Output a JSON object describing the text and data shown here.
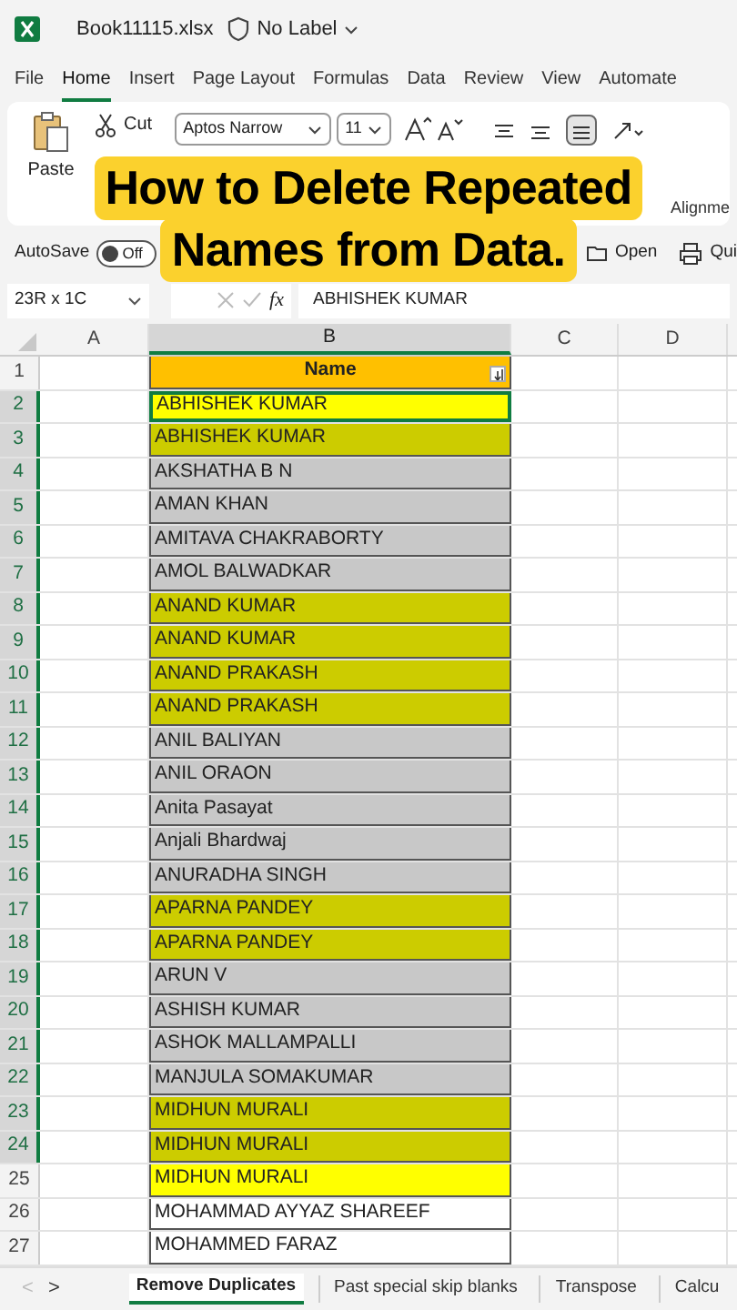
{
  "title_bar": {
    "file_name": "Book11115.xlsx",
    "label": "No Label"
  },
  "menu_tabs": [
    {
      "label": "File",
      "selected": false
    },
    {
      "label": "Home",
      "selected": true
    },
    {
      "label": "Insert",
      "selected": false
    },
    {
      "label": "Page Layout",
      "selected": false
    },
    {
      "label": "Formulas",
      "selected": false
    },
    {
      "label": "Data",
      "selected": false
    },
    {
      "label": "Review",
      "selected": false
    },
    {
      "label": "View",
      "selected": false
    },
    {
      "label": "Automate",
      "selected": false
    }
  ],
  "ribbon": {
    "paste": "Paste",
    "cut": "Cut",
    "font_name": "Aptos Narrow",
    "font_size": "11",
    "alignment_group": "Alignme"
  },
  "quick_bar": {
    "autosave": "AutoSave",
    "autosave_on": false,
    "toggle_label": "Off",
    "open": "Open",
    "quick": "Qui"
  },
  "formula_bar": {
    "name_box": "23R x 1C",
    "fx": "fx",
    "value": "ABHISHEK KUMAR"
  },
  "columns": [
    "A",
    "B",
    "C",
    "D"
  ],
  "header_row": {
    "row": "1",
    "label": "Name"
  },
  "rows": [
    {
      "row": "2",
      "name": "ABHISHEK KUMAR",
      "duplicate": true,
      "selected": true,
      "active": true
    },
    {
      "row": "3",
      "name": "ABHISHEK KUMAR",
      "duplicate": true,
      "selected": true,
      "active": false
    },
    {
      "row": "4",
      "name": "AKSHATHA B N",
      "duplicate": false,
      "selected": true,
      "active": false
    },
    {
      "row": "5",
      "name": "AMAN KHAN",
      "duplicate": false,
      "selected": true,
      "active": false
    },
    {
      "row": "6",
      "name": "AMITAVA CHAKRABORTY",
      "duplicate": false,
      "selected": true,
      "active": false
    },
    {
      "row": "7",
      "name": "AMOL BALWADKAR",
      "duplicate": false,
      "selected": true,
      "active": false
    },
    {
      "row": "8",
      "name": "ANAND KUMAR",
      "duplicate": true,
      "selected": true,
      "active": false
    },
    {
      "row": "9",
      "name": "ANAND KUMAR",
      "duplicate": true,
      "selected": true,
      "active": false
    },
    {
      "row": "10",
      "name": "ANAND PRAKASH",
      "duplicate": true,
      "selected": true,
      "active": false
    },
    {
      "row": "11",
      "name": "ANAND PRAKASH",
      "duplicate": true,
      "selected": true,
      "active": false
    },
    {
      "row": "12",
      "name": "ANIL BALIYAN",
      "duplicate": false,
      "selected": true,
      "active": false
    },
    {
      "row": "13",
      "name": "ANIL ORAON",
      "duplicate": false,
      "selected": true,
      "active": false
    },
    {
      "row": "14",
      "name": "Anita Pasayat",
      "duplicate": false,
      "selected": true,
      "active": false
    },
    {
      "row": "15",
      "name": "Anjali Bhardwaj",
      "duplicate": false,
      "selected": true,
      "active": false
    },
    {
      "row": "16",
      "name": "ANURADHA SINGH",
      "duplicate": false,
      "selected": true,
      "active": false
    },
    {
      "row": "17",
      "name": "APARNA PANDEY",
      "duplicate": true,
      "selected": true,
      "active": false
    },
    {
      "row": "18",
      "name": "APARNA PANDEY",
      "duplicate": true,
      "selected": true,
      "active": false
    },
    {
      "row": "19",
      "name": "ARUN V",
      "duplicate": false,
      "selected": true,
      "active": false
    },
    {
      "row": "20",
      "name": "ASHISH KUMAR",
      "duplicate": false,
      "selected": true,
      "active": false
    },
    {
      "row": "21",
      "name": "ASHOK MALLAMPALLI",
      "duplicate": false,
      "selected": true,
      "active": false
    },
    {
      "row": "22",
      "name": "MANJULA SOMAKUMAR",
      "duplicate": false,
      "selected": true,
      "active": false
    },
    {
      "row": "23",
      "name": "MIDHUN MURALI",
      "duplicate": true,
      "selected": true,
      "active": false
    },
    {
      "row": "24",
      "name": "MIDHUN MURALI",
      "duplicate": true,
      "selected": true,
      "active": false
    },
    {
      "row": "25",
      "name": "MIDHUN MURALI",
      "duplicate": true,
      "selected": false,
      "active": false
    },
    {
      "row": "26",
      "name": "MOHAMMAD AYYAZ SHAREEF",
      "duplicate": false,
      "selected": false,
      "active": false
    },
    {
      "row": "27",
      "name": "MOHAMMED FARAZ",
      "duplicate": false,
      "selected": false,
      "active": false
    }
  ],
  "sheet_nav": [
    "<",
    ">"
  ],
  "sheet_tabs": [
    {
      "label": "Remove Duplicates",
      "selected": true
    },
    {
      "label": "Past special skip blanks",
      "selected": false
    },
    {
      "label": "Transpose",
      "selected": false
    },
    {
      "label": "Calcu",
      "selected": false
    }
  ],
  "caption": [
    "How to Delete Repeated",
    "Names from Data."
  ]
}
